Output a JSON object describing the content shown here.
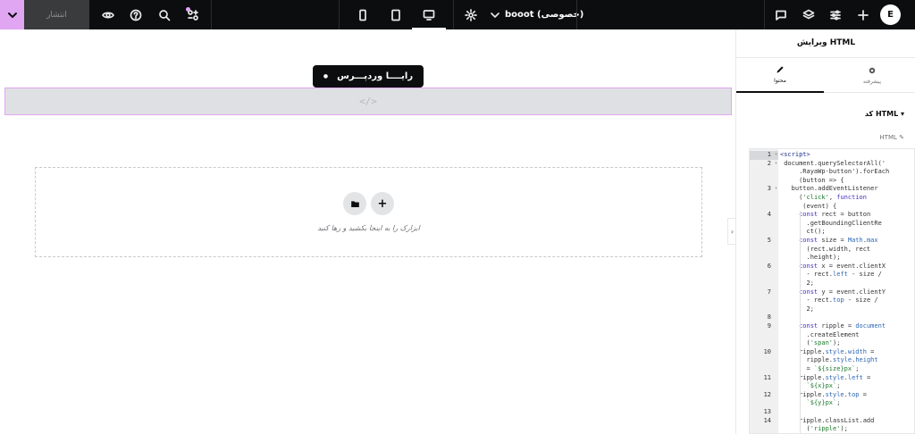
{
  "topbar": {
    "publish_label": "انتشار",
    "document_title": "booot (خصوصی)",
    "icons": {
      "publish_dropdown": "chevron-down-icon",
      "preview": "eye-icon",
      "help": "help-icon",
      "finder": "search-icon",
      "apps": "apps-icon",
      "mobile": "mobile-icon",
      "tablet": "tablet-icon",
      "desktop": "desktop-icon",
      "settings": "gear-icon",
      "notes": "chat-icon",
      "structure": "layers-icon",
      "site_settings": "sliders-icon",
      "add": "plus-icon",
      "logo": "elementor-logo-icon"
    },
    "logo_text": "E",
    "accent": "#e1a6f2"
  },
  "canvas": {
    "section_badge": "رایــــا وردپـــرس",
    "html_placeholder": "</>",
    "drop_hint": "ابزارک را به اینجا بکشید و رها کنید",
    "add_icon": "+",
    "folder_icon": "folder-icon"
  },
  "panel": {
    "title": "ویرایش HTML",
    "tabs": [
      {
        "label": "محتوا",
        "icon": "pencil-icon"
      },
      {
        "label": "پیشرفته",
        "icon": "gear-icon"
      }
    ],
    "section_title": "کد HTML",
    "field_label": "HTML",
    "code_lines": [
      {
        "n": "1",
        "fold": "▾",
        "html": "<span class=\"t\">&lt;script&gt;</span>"
      },
      {
        "n": "2",
        "fold": "▾",
        "html": " document.querySelectorAll('"
      },
      {
        "n": "",
        "fold": "",
        "html": "     .RayaWp-button').forEach"
      },
      {
        "n": "",
        "fold": "",
        "html": "     (button => {"
      },
      {
        "n": "3",
        "fold": "▾",
        "html": "   button.addEventListener"
      },
      {
        "n": "",
        "fold": "",
        "html": "     (<span class=\"s\">'click'</span>, <span class=\"k\">function</span>"
      },
      {
        "n": "",
        "fold": "",
        "html": "      (event) {"
      },
      {
        "n": "4",
        "fold": "",
        "html": "     <span class=\"k\">const</span> rect = button"
      },
      {
        "n": "",
        "fold": "",
        "html": "       .getBoundingClientRe"
      },
      {
        "n": "",
        "fold": "",
        "html": "       ct();"
      },
      {
        "n": "5",
        "fold": "",
        "html": "     <span class=\"k\">const</span> size = <span class=\"p\">Math</span>.<span class=\"p\">max</span>"
      },
      {
        "n": "",
        "fold": "",
        "html": "       (rect.width, rect"
      },
      {
        "n": "",
        "fold": "",
        "html": "       .height);"
      },
      {
        "n": "6",
        "fold": "",
        "html": "     <span class=\"k\">const</span> x = event.clientX"
      },
      {
        "n": "",
        "fold": "",
        "html": "       - rect.<span class=\"p\">left</span> - size /"
      },
      {
        "n": "",
        "fold": "",
        "html": "       2;"
      },
      {
        "n": "7",
        "fold": "",
        "html": "     <span class=\"k\">const</span> y = event.clientY"
      },
      {
        "n": "",
        "fold": "",
        "html": "       - rect.<span class=\"p\">top</span> - size /"
      },
      {
        "n": "",
        "fold": "",
        "html": "       2;"
      },
      {
        "n": "8",
        "fold": "",
        "html": ""
      },
      {
        "n": "9",
        "fold": "",
        "html": "     <span class=\"k\">const</span> ripple = <span class=\"p\">document</span>"
      },
      {
        "n": "",
        "fold": "",
        "html": "       .createElement"
      },
      {
        "n": "",
        "fold": "",
        "html": "       (<span class=\"s\">'span'</span>);"
      },
      {
        "n": "10",
        "fold": "",
        "html": "     ripple.<span class=\"p\">style</span>.<span class=\"p\">width</span> ="
      },
      {
        "n": "",
        "fold": "",
        "html": "       ripple.<span class=\"p\">style</span>.<span class=\"p\">height</span>"
      },
      {
        "n": "",
        "fold": "",
        "html": "       = <span class=\"s\">`${size}px`</span>;"
      },
      {
        "n": "11",
        "fold": "",
        "html": "     ripple.<span class=\"p\">style</span>.<span class=\"p\">left</span> ="
      },
      {
        "n": "",
        "fold": "",
        "html": "       <span class=\"s\">`${x}px`</span>;"
      },
      {
        "n": "12",
        "fold": "",
        "html": "     ripple.<span class=\"p\">style</span>.<span class=\"p\">top</span> ="
      },
      {
        "n": "",
        "fold": "",
        "html": "       <span class=\"s\">`${y}px`</span>;"
      },
      {
        "n": "13",
        "fold": "",
        "html": ""
      },
      {
        "n": "14",
        "fold": "",
        "html": "     ripple.classList.add"
      },
      {
        "n": "",
        "fold": "",
        "html": "       (<span class=\"s\">'ripple'</span>);"
      }
    ]
  }
}
